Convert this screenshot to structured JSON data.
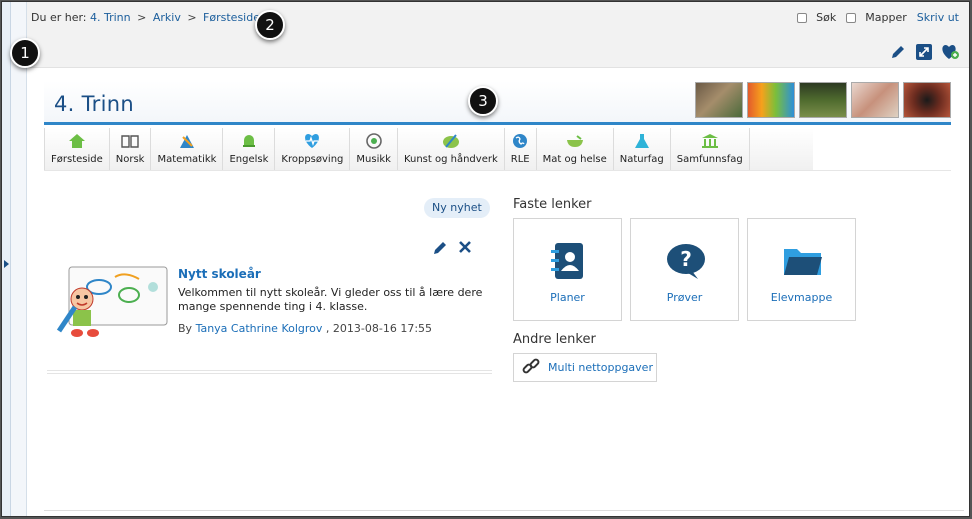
{
  "breadcrumb": {
    "prefix": "Du er her:",
    "items": [
      "4. Trinn",
      "Arkiv",
      "Førstesider"
    ],
    "separator": ">"
  },
  "topbar": {
    "search_label": "Søk",
    "folders_label": "Mapper",
    "logout_label": "Skriv ut"
  },
  "callouts": [
    "1",
    "2",
    "3"
  ],
  "site": {
    "title": "4. Trinn",
    "accent_color": "#2f86c8",
    "title_color": "#1b4f86"
  },
  "nav": {
    "items": [
      {
        "label": "Førsteside",
        "icon": "home-icon"
      },
      {
        "label": "Norsk",
        "icon": "book-icon"
      },
      {
        "label": "Matematikk",
        "icon": "geometry-icon"
      },
      {
        "label": "Engelsk",
        "icon": "bell-icon"
      },
      {
        "label": "Kroppsøving",
        "icon": "heart-icon"
      },
      {
        "label": "Musikk",
        "icon": "music-icon"
      },
      {
        "label": "Kunst og håndverk",
        "icon": "palette-icon"
      },
      {
        "label": "RLE",
        "icon": "globe-icon"
      },
      {
        "label": "Mat og helse",
        "icon": "bowl-icon"
      },
      {
        "label": "Naturfag",
        "icon": "flask-icon"
      },
      {
        "label": "Samfunnsfag",
        "icon": "building-icon"
      }
    ]
  },
  "news": {
    "new_button": "Ny nyhet",
    "title": "Nytt skoleår",
    "body": "Velkommen til nytt skoleår. Vi gleder oss til å lære dere mange spennende ting i 4. klasse.",
    "by_prefix": "By",
    "author": "Tanya Cathrine Kolgrov",
    "date": ", 2013-08-16 17:55"
  },
  "quick_links": {
    "title": "Faste lenker",
    "items": [
      {
        "label": "Planer",
        "icon": "contacts-icon"
      },
      {
        "label": "Prøver",
        "icon": "question-bubble-icon"
      },
      {
        "label": "Elevmappe",
        "icon": "folder-icon"
      }
    ]
  },
  "other_links": {
    "title": "Andre lenker",
    "items": [
      {
        "label": "Multi nettoppgaver",
        "icon": "link-icon"
      }
    ]
  }
}
